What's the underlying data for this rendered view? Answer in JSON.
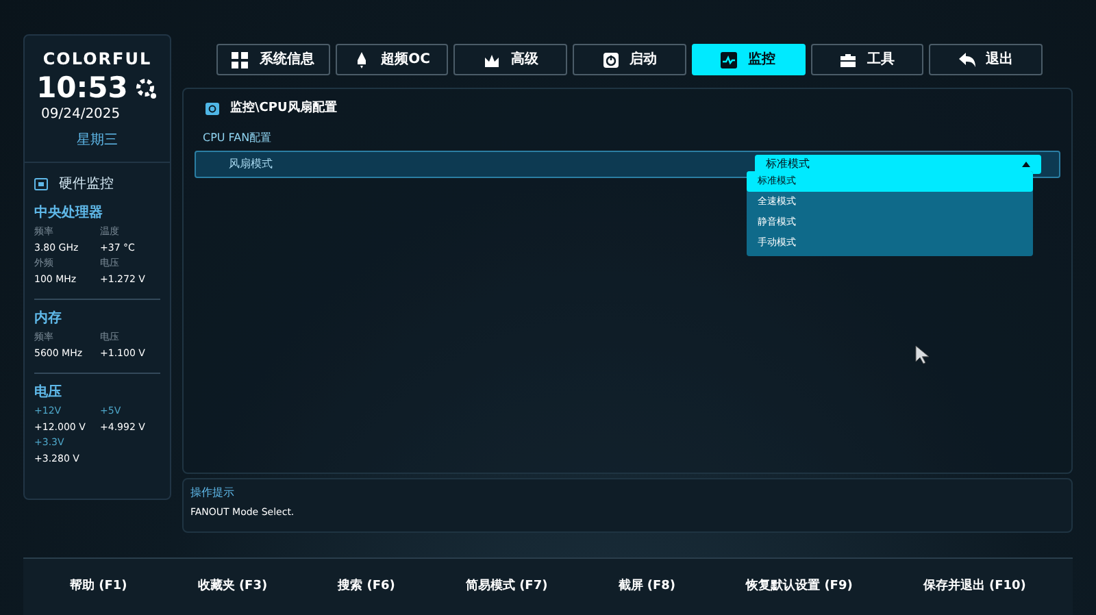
{
  "brand": {
    "logo": "COLORFUL",
    "time": "10:53",
    "date": "09/24/2025",
    "weekday": "星期三"
  },
  "hardware": {
    "title": "硬件监控",
    "groups": [
      {
        "title": "中央处理器",
        "items": [
          {
            "label": "频率",
            "value": "3.80 GHz",
            "kind": "plain"
          },
          {
            "label": "温度",
            "value": "+37 °C",
            "kind": "plain"
          },
          {
            "label": "外频",
            "value": "100 MHz",
            "kind": "plain"
          },
          {
            "label": "电压",
            "value": "+1.272 V",
            "kind": "plain"
          }
        ]
      },
      {
        "title": "内存",
        "items": [
          {
            "label": "频率",
            "value": "5600 MHz",
            "kind": "plain"
          },
          {
            "label": "电压",
            "value": "+1.100 V",
            "kind": "plain"
          }
        ]
      },
      {
        "title": "电压",
        "items": [
          {
            "label": "+12V",
            "value": "+12.000 V",
            "kind": "rail"
          },
          {
            "label": "+5V",
            "value": "+4.992 V",
            "kind": "rail"
          },
          {
            "label": "+3.3V",
            "value": "+3.280 V",
            "kind": "rail"
          }
        ]
      }
    ]
  },
  "tabs": [
    {
      "label": "系统信息",
      "kind": "grid",
      "selected": false
    },
    {
      "label": "超频OC",
      "kind": "rocket",
      "selected": false
    },
    {
      "label": "高级",
      "kind": "crown",
      "selected": false
    },
    {
      "label": "启动",
      "kind": "power",
      "selected": false
    },
    {
      "label": "监控",
      "kind": "pulse",
      "selected": true
    },
    {
      "label": "工具",
      "kind": "toolbox",
      "selected": false
    },
    {
      "label": "退出",
      "kind": "back",
      "selected": false
    }
  ],
  "breadcrumb": "监控\\CPU风扇配置",
  "section": "CPU FAN配置",
  "setting": {
    "label": "风扇模式",
    "value": "标准模式",
    "expanded": true,
    "options": [
      {
        "label": "标准模式",
        "selected": true
      },
      {
        "label": "全速模式",
        "selected": false
      },
      {
        "label": "静音模式",
        "selected": false
      },
      {
        "label": "手动模式",
        "selected": false
      }
    ]
  },
  "hint": {
    "title": "操作提示",
    "text": "FANOUT Mode Select."
  },
  "footer": [
    "帮助 (F1)",
    "收藏夹 (F3)",
    "搜索 (F6)",
    "简易模式 (F7)",
    "截屏 (F8)",
    "恢复默认设置 (F9)",
    "保存并退出 (F10)"
  ]
}
